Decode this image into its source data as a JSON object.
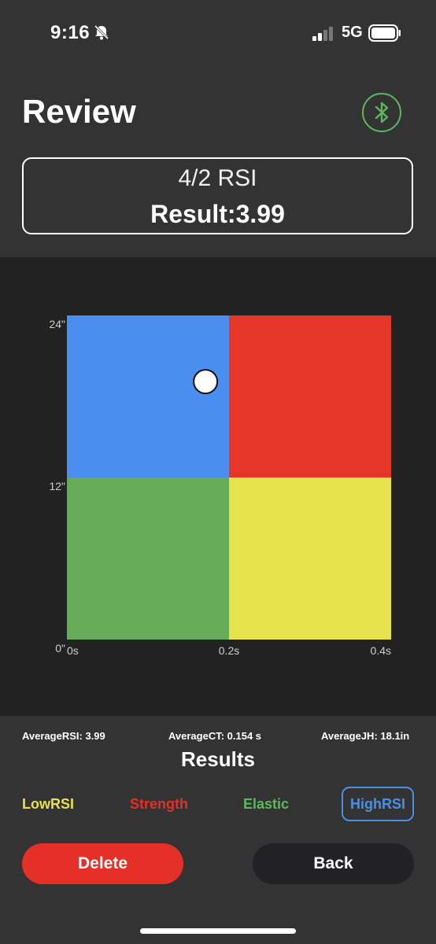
{
  "status_bar": {
    "time": "9:16",
    "network": "5G",
    "icons": [
      "bell-slash-icon",
      "signal-icon",
      "battery-icon"
    ]
  },
  "header": {
    "title": "Review",
    "bluetooth_icon": "bluetooth-icon",
    "accent_color": "#5cb85c"
  },
  "result_card": {
    "test_name": "4/2 RSI",
    "result_text": "Result:3.99"
  },
  "chart_data": {
    "type": "scatter",
    "x_ticks": [
      "0s",
      "0.2s",
      "0.4s"
    ],
    "y_ticks": [
      "24\"",
      "12\"",
      "0\""
    ],
    "xlim": [
      0,
      0.4
    ],
    "ylim": [
      0,
      24
    ],
    "quadrants": [
      {
        "name": "HighRSI",
        "color": "#4a8ff0",
        "x": [
          0,
          0.2
        ],
        "y": [
          12,
          24
        ]
      },
      {
        "name": "Strength",
        "color": "#e63529",
        "x": [
          0.2,
          0.4
        ],
        "y": [
          12,
          24
        ]
      },
      {
        "name": "Elastic",
        "color": "#66ab57",
        "x": [
          0,
          0.2
        ],
        "y": [
          0,
          12
        ]
      },
      {
        "name": "LowRSI",
        "color": "#e6e24c",
        "x": [
          0.2,
          0.4
        ],
        "y": [
          0,
          12
        ]
      }
    ],
    "points": [
      {
        "x": 0.171,
        "y": 19.1
      }
    ]
  },
  "stats": {
    "average_rsi": "AverageRSI: 3.99",
    "average_ct": "AverageCT: 0.154 s",
    "average_jh": "AverageJH: 18.1in"
  },
  "results": {
    "heading": "Results",
    "legend": [
      {
        "label": "LowRSI",
        "color": "#e6e24c"
      },
      {
        "label": "Strength",
        "color": "#e53027"
      },
      {
        "label": "Elastic",
        "color": "#5cb85c"
      },
      {
        "label": "HighRSI",
        "color": "#4a90e2",
        "selected": true
      }
    ]
  },
  "actions": {
    "delete_label": "Delete",
    "back_label": "Back"
  }
}
